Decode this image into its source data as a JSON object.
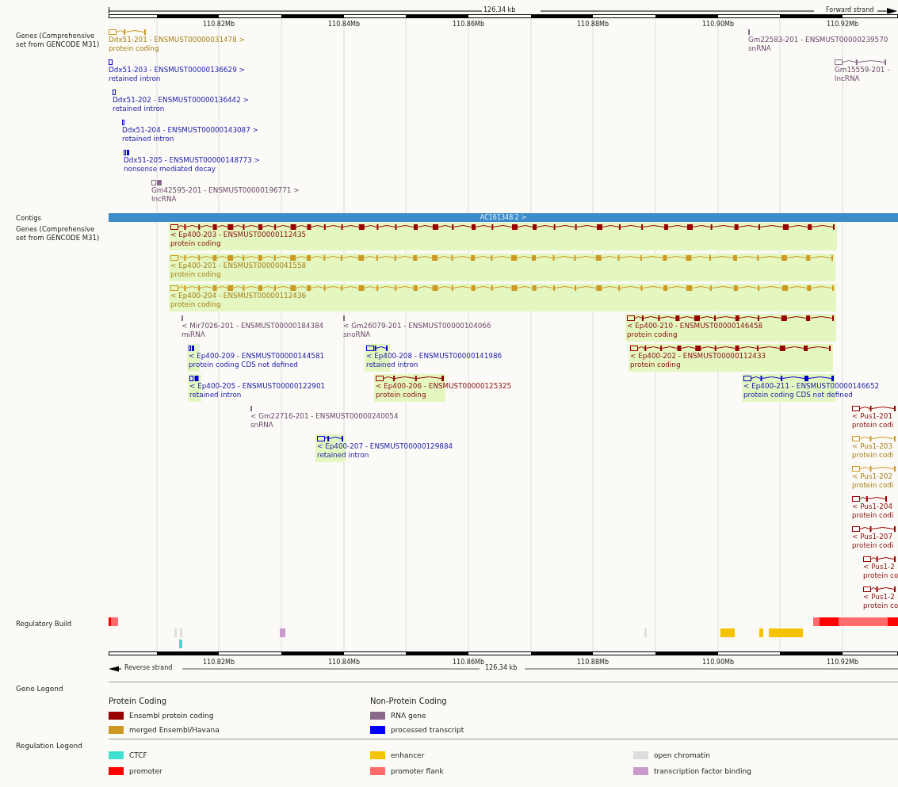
{
  "ruler_top": {
    "length": "126.34 kb",
    "strand": "Forward strand",
    "ticks": [
      "110.82Mb",
      "110.84Mb",
      "110.86Mb",
      "110.88Mb",
      "110.90Mb",
      "110.92Mb"
    ]
  },
  "tracks": [
    {
      "kind": "genes",
      "label": "Genes (Comprehensive set from GENCODE M31)",
      "transcripts": [
        {
          "name": "Ddx51-201 - ENSMUST00000031478 >",
          "biotype": "protein coding",
          "kind": "merged",
          "highlighted": false
        },
        {
          "name": "Gm22583-201 - ENSMUST00000239570",
          "biotype": "snRNA",
          "kind": "rna",
          "highlighted": false
        },
        {
          "name": "Ddx51-203 - ENSMUST00000136629 >",
          "biotype": "retained intron",
          "kind": "processed",
          "highlighted": false
        },
        {
          "name": "Gm15559-201 -",
          "biotype": "lncRNA",
          "kind": "rna",
          "highlighted": false
        },
        {
          "name": "Ddx51-202 - ENSMUST00000136442 >",
          "biotype": "retained intron",
          "kind": "processed",
          "highlighted": false
        },
        {
          "name": "Ddx51-204 - ENSMUST00000143087 >",
          "biotype": "retained intron",
          "kind": "processed",
          "highlighted": false
        },
        {
          "name": "Ddx51-205 - ENSMUST00000148773 >",
          "biotype": "nonsense mediated decay",
          "kind": "processed",
          "highlighted": false
        },
        {
          "name": "Gm42595-201 - ENSMUST00000196771 >",
          "biotype": "lncRNA",
          "kind": "rna",
          "highlighted": false
        }
      ]
    },
    {
      "kind": "contigs",
      "label": "Contigs",
      "contig": "AC161348.2 >"
    },
    {
      "kind": "genes",
      "label": "Genes (Comprehensive set from GENCODE M31)",
      "transcripts": [
        {
          "name": "< Ep400-203 - ENSMUST00000112435",
          "biotype": "protein coding",
          "kind": "ensembl",
          "highlighted": true
        },
        {
          "name": "< Ep400-201 - ENSMUST00000041558",
          "biotype": "protein coding",
          "kind": "merged",
          "highlighted": true
        },
        {
          "name": "< Ep400-204 - ENSMUST00000112436",
          "biotype": "protein coding",
          "kind": "merged",
          "highlighted": true
        },
        {
          "name": "< Mir7026-201 - ENSMUST00000184384",
          "biotype": "miRNA",
          "kind": "rna",
          "highlighted": false
        },
        {
          "name": "< Gm26079-201 - ENSMUST00000104066",
          "biotype": "snoRNA",
          "kind": "rna",
          "highlighted": false
        },
        {
          "name": "< Ep400-210 - ENSMUST00000146458",
          "biotype": "protein coding",
          "kind": "ensembl",
          "highlighted": true
        },
        {
          "name": "< Ep400-209 - ENSMUST00000144581",
          "biotype": "protein coding CDS not defined",
          "kind": "processed",
          "highlighted": true
        },
        {
          "name": "< Ep400-208 - ENSMUST00000141986",
          "biotype": "retained intron",
          "kind": "processed",
          "highlighted": true
        },
        {
          "name": "< Ep400-202 - ENSMUST00000112433",
          "biotype": "protein coding",
          "kind": "ensembl",
          "highlighted": true
        },
        {
          "name": "< Ep400-205 - ENSMUST00000122901",
          "biotype": "retained intron",
          "kind": "processed",
          "highlighted": true
        },
        {
          "name": "< Ep400-206 - ENSMUST00000125325",
          "biotype": "protein coding",
          "kind": "ensembl",
          "highlighted": true
        },
        {
          "name": "< Ep400-211 - ENSMUST00000146652",
          "biotype": "protein coding CDS not defined",
          "kind": "processed",
          "highlighted": true
        },
        {
          "name": "< Gm22716-201 - ENSMUST00000240054",
          "biotype": "snRNA",
          "kind": "rna",
          "highlighted": false
        },
        {
          "name": "< Pus1-201",
          "biotype": "protein codi",
          "kind": "ensembl",
          "highlighted": false
        },
        {
          "name": "< Ep400-207 - ENSMUST00000129884",
          "biotype": "retained intron",
          "kind": "processed",
          "highlighted": true
        },
        {
          "name": "< Pus1-203",
          "biotype": "protein codi",
          "kind": "merged",
          "highlighted": false
        },
        {
          "name": "< Pus1-202",
          "biotype": "protein codi",
          "kind": "merged",
          "highlighted": false
        },
        {
          "name": "< Pus1-204",
          "biotype": "protein codi",
          "kind": "ensembl",
          "highlighted": false
        },
        {
          "name": "< Pus1-207",
          "biotype": "protein codi",
          "kind": "ensembl",
          "highlighted": false
        },
        {
          "name": "< Pus1-2",
          "biotype": "protein co",
          "kind": "ensembl",
          "highlighted": false
        },
        {
          "name": "< Pus1-2",
          "biotype": "protein co",
          "kind": "ensembl",
          "highlighted": false
        }
      ]
    },
    {
      "kind": "regulation",
      "label": "Regulatory Build"
    }
  ],
  "ruler_bottom": {
    "length": "126.34 kb",
    "strand": "Reverse strand",
    "ticks": [
      "110.82Mb",
      "110.84Mb",
      "110.86Mb",
      "110.88Mb",
      "110.90Mb",
      "110.92Mb"
    ]
  },
  "gene_legend": {
    "label": "Gene Legend",
    "groups": [
      {
        "title": "Protein Coding",
        "items": [
          {
            "label": "Ensembl protein coding",
            "color": "#990000"
          },
          {
            "label": "merged Ensembl/Havana",
            "color": "#cc9922"
          }
        ]
      },
      {
        "title": "Non-Protein Coding",
        "items": [
          {
            "label": "RNA gene",
            "color": "#8a6a8a"
          },
          {
            "label": "processed transcript",
            "color": "#0000ff"
          }
        ]
      }
    ]
  },
  "regulation_legend": {
    "label": "Regulation Legend",
    "items": [
      {
        "label": "CTCF",
        "color": "#40e0d0"
      },
      {
        "label": "promoter",
        "color": "#ff0000"
      },
      {
        "label": "enhancer",
        "color": "#f5c200"
      },
      {
        "label": "promoter flank",
        "color": "#ff6a6a"
      },
      {
        "label": "open chromatin",
        "color": "#dddddd"
      },
      {
        "label": "transcription factor binding",
        "color": "#cc99cc"
      }
    ]
  }
}
